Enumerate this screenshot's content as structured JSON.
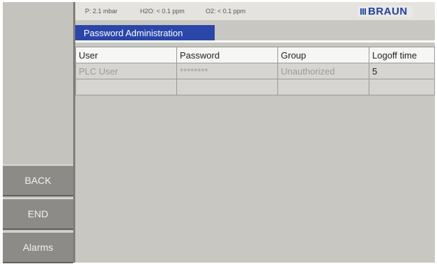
{
  "status": {
    "pressure": "P:  2.1 mbar",
    "h2o": "H2O:  < 0.1 ppm",
    "o2": "O2:  < 0.1 ppm",
    "logo": "BRAUN"
  },
  "title": "Password Administration",
  "table": {
    "headers": [
      "User",
      "Password",
      "Group",
      "Logoff time"
    ],
    "rows": [
      [
        "PLC User",
        "********",
        "Unauthorized",
        "5"
      ],
      [
        "",
        "",
        "",
        ""
      ]
    ]
  },
  "buttons": {
    "back": "BACK",
    "end": "END",
    "alarms": "Alarms"
  }
}
